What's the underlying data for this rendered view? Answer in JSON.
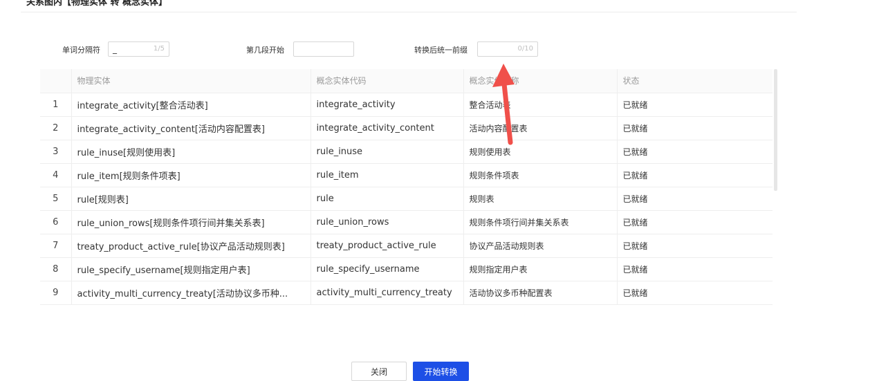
{
  "dialog": {
    "title": "关系图内【物理实体 转 概念实体】"
  },
  "form": {
    "separator": {
      "label": "单词分隔符",
      "value": "_",
      "counter": "1/5"
    },
    "segment_start": {
      "label": "第几段开始",
      "value": ""
    },
    "prefix": {
      "label": "转换后统一前缀",
      "value": "",
      "counter": "0/10"
    }
  },
  "table": {
    "columns": [
      "",
      "物理实体",
      "概念实体代码",
      "概念实体名称",
      "状态"
    ],
    "rows": [
      {
        "index": "1",
        "physical": "integrate_activity[整合活动表]",
        "code": "integrate_activity",
        "name": "整合活动表",
        "status": "已就绪"
      },
      {
        "index": "2",
        "physical": "integrate_activity_content[活动内容配置表]",
        "code": "integrate_activity_content",
        "name": "活动内容配置表",
        "status": "已就绪"
      },
      {
        "index": "3",
        "physical": "rule_inuse[规则使用表]",
        "code": "rule_inuse",
        "name": "规则使用表",
        "status": "已就绪"
      },
      {
        "index": "4",
        "physical": "rule_item[规则条件项表]",
        "code": "rule_item",
        "name": "规则条件项表",
        "status": "已就绪"
      },
      {
        "index": "5",
        "physical": "rule[规则表]",
        "code": "rule",
        "name": "规则表",
        "status": "已就绪"
      },
      {
        "index": "6",
        "physical": "rule_union_rows[规则条件项行间并集关系表]",
        "code": "rule_union_rows",
        "name": "规则条件项行间并集关系表",
        "status": "已就绪"
      },
      {
        "index": "7",
        "physical": "treaty_product_active_rule[协议产品活动规则表]",
        "code": "treaty_product_active_rule",
        "name": "协议产品活动规则表",
        "status": "已就绪"
      },
      {
        "index": "8",
        "physical": "rule_specify_username[规则指定用户表]",
        "code": "rule_specify_username",
        "name": "规则指定用户表",
        "status": "已就绪"
      },
      {
        "index": "9",
        "physical": "activity_multi_currency_treaty[活动协议多币种...",
        "code": "activity_multi_currency_treaty",
        "name": "活动协议多币种配置表",
        "status": "已就绪"
      }
    ]
  },
  "buttons": {
    "close": "关闭",
    "start": "开始转换"
  },
  "colors": {
    "primary": "#1d4fe6",
    "arrow": "#f0504a"
  }
}
